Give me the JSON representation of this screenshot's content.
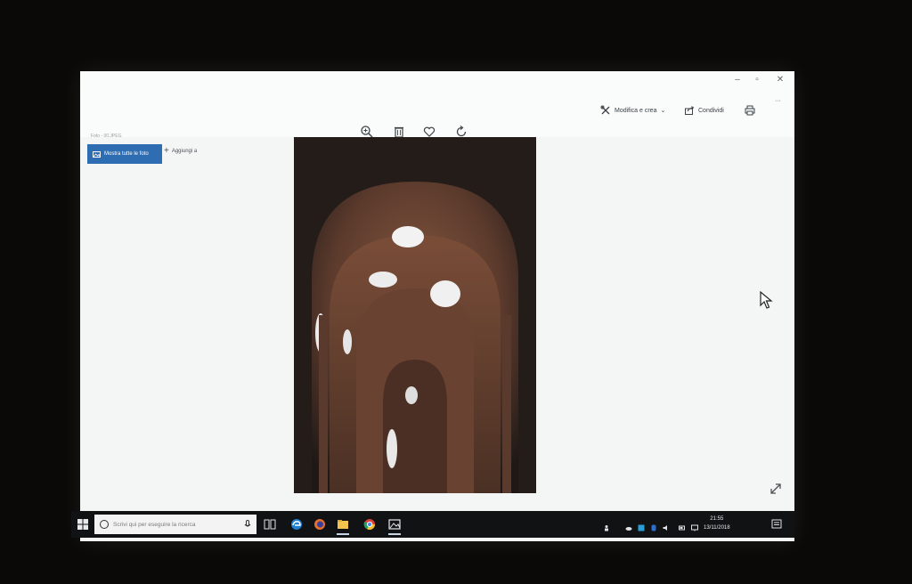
{
  "window": {
    "title": "Foto - 00.JPEG",
    "controls": {
      "minimize": "–",
      "maximize": "▫",
      "close": "✕"
    }
  },
  "toolbar": {
    "icons": [
      "zoom-icon",
      "trash-icon",
      "heart-icon",
      "rotate-icon"
    ],
    "edit_label": "Modifica e crea",
    "share_label": "Condividi",
    "more_label": "···"
  },
  "sidebar": {
    "show_all_label": "Mostra tutte le foto",
    "add_label": "Aggiungi a"
  },
  "photo": {
    "subject": "church-dome-interior"
  },
  "taskbar": {
    "search_placeholder": "Scrivi qui per eseguire la ricerca",
    "apps": [
      "task-view-icon",
      "edge-icon",
      "firefox-icon",
      "file-explorer-icon",
      "chrome-icon",
      "photos-icon"
    ],
    "active_app": "photos-icon",
    "time": "21:55",
    "date": "13/11/2018"
  },
  "colors": {
    "accent": "#2f6db3",
    "taskbar": "#101214",
    "window": "#f4f6f6"
  }
}
